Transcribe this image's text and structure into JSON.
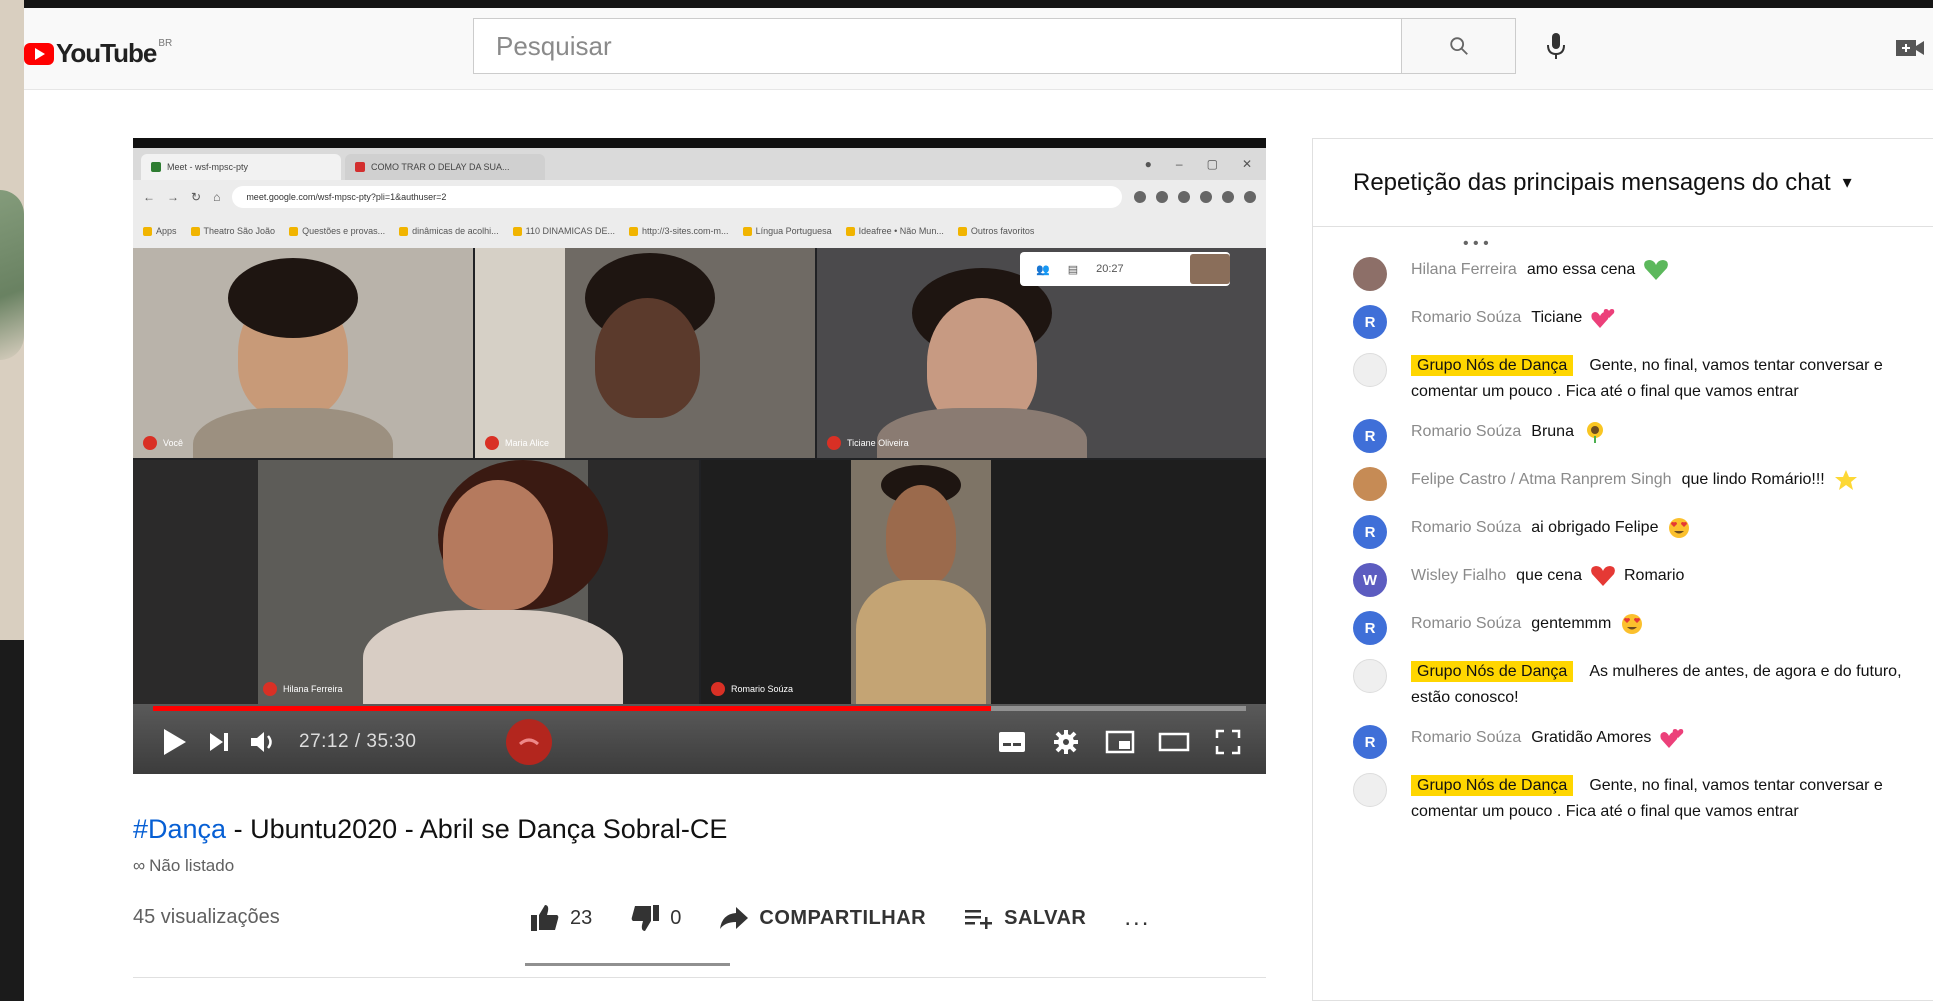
{
  "masthead": {
    "logo_text": "YouTube",
    "country_code": "BR",
    "search_placeholder": "Pesquisar"
  },
  "player": {
    "browser_tab_1": "Meet - wsf-mpsc-pty",
    "browser_tab_2": "COMO TRAR O DELAY DA SUA...",
    "url": "meet.google.com/wsf-mpsc-pty?pli=1&authuser=2",
    "bookmarks": [
      "Apps",
      "Theatro São João",
      "Questões e provas...",
      "dinâmicas de acolhi...",
      "110 DINAMICAS DE...",
      "http://3-sites.com-m...",
      "Língua Portuguesa",
      "Ideafree • Não Mun...",
      "Outros favoritos"
    ],
    "meet_clock": "20:27",
    "participants": [
      "Você",
      "Maria Alice",
      "Ticiane Oliveira",
      "Hilana Ferreira",
      "Romario Soúza"
    ],
    "progress": 0.767,
    "time_display": "27:12 / 35:30"
  },
  "video": {
    "title_tag": "#Dança",
    "title_rest": " - Ubuntu2020 - Abril se Dança Sobral-CE",
    "unlisted": "Não listado",
    "views": "45 visualizações",
    "likes": "23",
    "dislikes": "0",
    "share_label": "COMPARTILHAR",
    "save_label": "SALVAR",
    "more": "..."
  },
  "chat": {
    "header": "Repetição das principais mensagens do chat",
    "messages": [
      {
        "author": "Hilana Ferreira",
        "text": "amo essa cena",
        "avatar": "photo",
        "emoji": "green-heart"
      },
      {
        "author": "Romario Soúza",
        "text": "Ticiane",
        "avatar": "R",
        "emoji": "two-hearts"
      },
      {
        "author": "Grupo Nós de Dança",
        "text": "Gente, no final, vamos tentar conversar e comentar um pouco . Fica até o final que vamos entrar",
        "avatar": "group",
        "highlight": true
      },
      {
        "author": "Romario Soúza",
        "text": "Bruna",
        "avatar": "R",
        "emoji": "sunflower"
      },
      {
        "author": "Felipe Castro / Atma Ranprem Singh",
        "text": "que lindo Romário!!!",
        "avatar": "photo",
        "emoji": "dizzy"
      },
      {
        "author": "Romario Soúza",
        "text": "ai obrigado Felipe",
        "avatar": "R",
        "emoji": "heart-eyes"
      },
      {
        "author": "Wisley Fialho",
        "text": "que cena",
        "avatar": "W",
        "emoji": "red-heart",
        "text_after": "Romario"
      },
      {
        "author": "Romario Soúza",
        "text": "gentemmm",
        "avatar": "R",
        "emoji": "heart-eyes"
      },
      {
        "author": "Grupo Nós de Dança",
        "text": "As mulheres de antes, de agora e do futuro, estão conosco!",
        "avatar": "group",
        "highlight": true
      },
      {
        "author": "Romario Soúza",
        "text": "Gratidão Amores",
        "avatar": "R",
        "emoji": "two-hearts"
      },
      {
        "author": "Grupo Nós de Dança",
        "text": "Gente, no final, vamos tentar conversar e comentar um pouco . Fica até o final que vamos entrar",
        "avatar": "group",
        "highlight": true
      }
    ]
  },
  "colors": {
    "youtube_red": "#ff0000",
    "link_blue": "#065fd4",
    "highlight_yellow": "#ffd600",
    "avatar_blue": "#3f6fd8"
  }
}
